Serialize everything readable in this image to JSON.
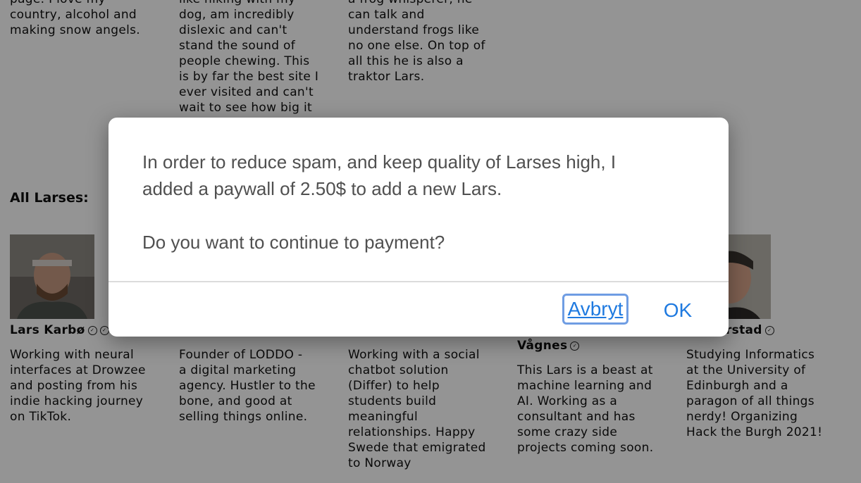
{
  "top_snippets": [
    {
      "lines": [
        "page. I love my",
        "country, alcohol and",
        "making snow angels."
      ]
    },
    {
      "lines": [
        "like hiking with my",
        "dog, am incredibly",
        "dislexic and can't",
        "stand the sound of",
        "people chewing. This",
        "is by far the best site I",
        "ever visited and can't",
        "wait to see how big it"
      ]
    },
    {
      "lines": [
        "a frog whisperer, he",
        "can talk and",
        "understand frogs like",
        "no one else. On top of",
        "all this he is also a",
        "traktor Lars."
      ]
    }
  ],
  "all_heading": "All Larses:",
  "profiles": [
    {
      "name": "Lars Karbø",
      "bio_lines": [
        "Working with neural",
        "interfaces at Drowzee",
        "and posting from his",
        "indie hacking journey",
        "on TikTok."
      ]
    },
    {
      "name": "",
      "bio_lines": [
        "Founder of LODDO -",
        "a digital marketing",
        "agency. Hustler to the",
        "bone, and good at",
        "selling things online."
      ]
    },
    {
      "name": "",
      "bio_lines": [
        "Working with a social",
        "chatbot solution",
        "(Differ) to help",
        "students build",
        "meaningful",
        "relationships. Happy",
        "Swede that emigrated",
        "to Norway"
      ]
    },
    {
      "name": "Vågnes",
      "bio_lines": [
        "This Lars is a beast at",
        "machine learning and",
        "AI. Working as a",
        "consultant and has",
        "some crazy side",
        "projects coming soon."
      ]
    },
    {
      "name": "orstad",
      "bio_lines": [
        "Studying Informatics",
        "at the University of",
        "Edinburgh and a",
        "paragon of all things",
        "nerdy! Organizing",
        "Hack the Burgh 2021!"
      ]
    }
  ],
  "dialog": {
    "message_line1": "In order to reduce spam, and keep quality of Larses high, I",
    "message_line2": "added a paywall of 2.50$ to add a new Lars.",
    "question": "Do you want to continue to payment?",
    "cancel_label": "Avbryt",
    "ok_label": "OK"
  },
  "colors": {
    "accent": "#1f7ae0",
    "overlay": "#000000"
  }
}
